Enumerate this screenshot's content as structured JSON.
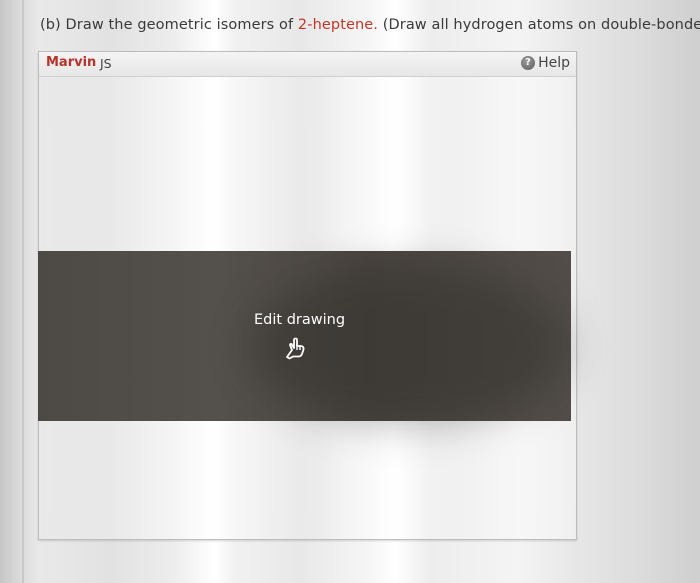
{
  "question": {
    "prefix": "(b) Draw the geometric isomers of ",
    "compound": "2-heptene.",
    "suffix": " (Draw all hydrogen atoms on double-bonded c"
  },
  "marvin": {
    "brand": "Marvin",
    "brand_suffix": "JS",
    "help_icon_glyph": "?",
    "help_label": "Help"
  },
  "overlay": {
    "label": "Edit drawing",
    "icon": "pointing-hand-icon"
  },
  "colors": {
    "brand": "#b8332b",
    "highlight": "#c2362a",
    "overlay": "#4d4945"
  }
}
